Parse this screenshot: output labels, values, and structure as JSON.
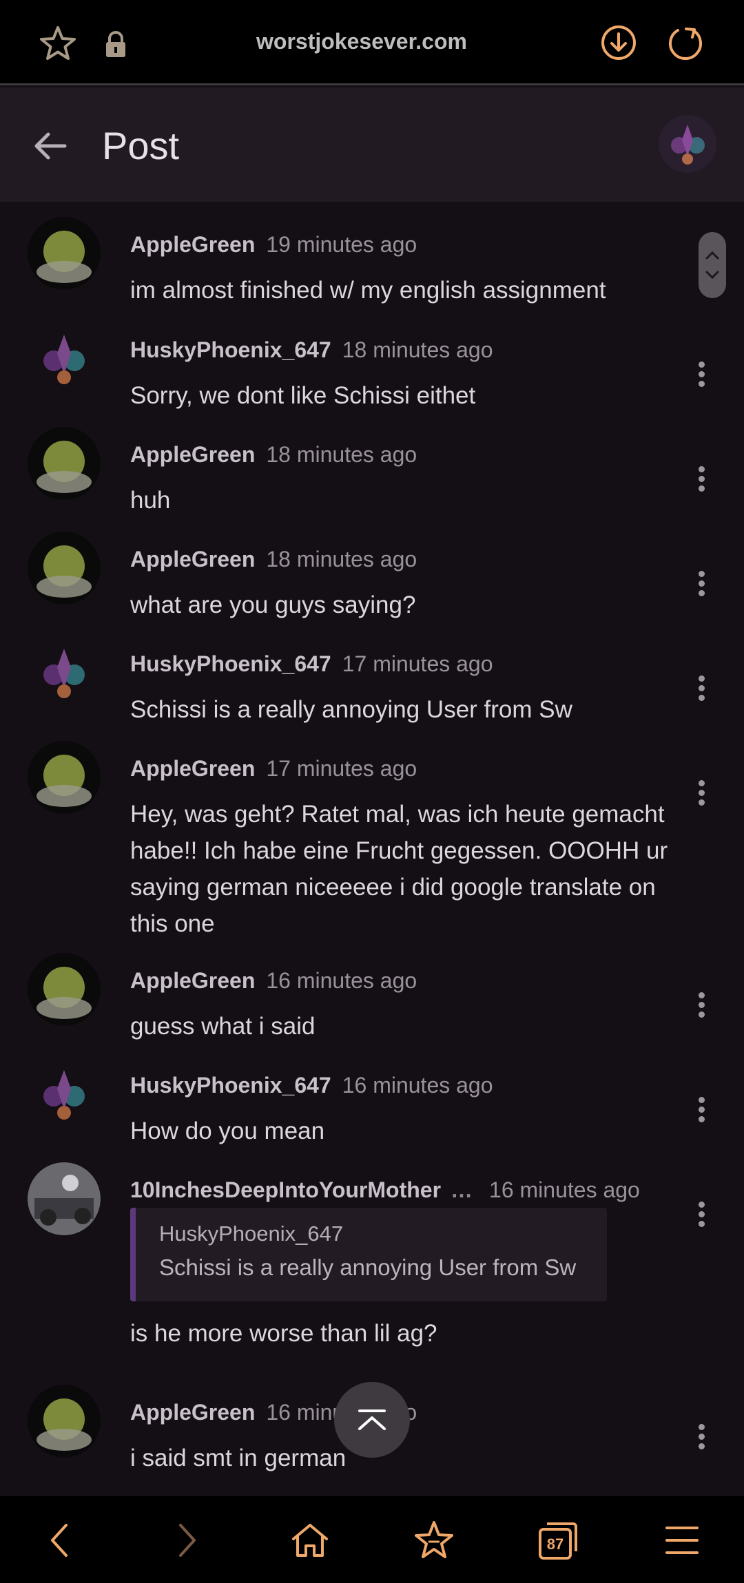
{
  "browser": {
    "url": "worstjokesever.com",
    "tab_count": "87",
    "accent_color": "#f0a86a"
  },
  "header": {
    "title": "Post"
  },
  "comments": [
    {
      "author": "AppleGreen",
      "time": "19 minutes ago",
      "text": "im almost finished w/ my english assignment",
      "avatar": "apple-avatar"
    },
    {
      "author": "HuskyPhoenix_647",
      "time": "18 minutes ago",
      "text": "Sorry, we dont like Schissi eithet",
      "avatar": "phoenix-avatar"
    },
    {
      "author": "AppleGreen",
      "time": "18 minutes ago",
      "text": "huh",
      "avatar": "apple-avatar"
    },
    {
      "author": "AppleGreen",
      "time": "18 minutes ago",
      "text": "what are you guys saying?",
      "avatar": "apple-avatar"
    },
    {
      "author": "HuskyPhoenix_647",
      "time": "17 minutes ago",
      "text": "Schissi is a really annoying User from Sw",
      "avatar": "phoenix-avatar"
    },
    {
      "author": "AppleGreen",
      "time": "17 minutes ago",
      "text": "Hey, was geht? Ratet mal, was ich heute gemacht habe!! Ich habe eine Frucht gegessen. OOOHH ur saying german niceeeee i did google translate on this one",
      "avatar": "apple-avatar"
    },
    {
      "author": "AppleGreen",
      "time": "16 minutes ago",
      "text": "guess what i said",
      "avatar": "apple-avatar"
    },
    {
      "author": "HuskyPhoenix_647",
      "time": "16 minutes ago",
      "text": "How do you mean",
      "avatar": "phoenix-avatar"
    },
    {
      "author": "10InchesDeepIntoYourMother",
      "author_badge": "…",
      "time": "16 minutes ago",
      "quote_author": "HuskyPhoenix_647",
      "quote_text": "Schissi is a really annoying User from Sw",
      "text": "is he more worse than lil ag?",
      "avatar": "photo-avatar"
    },
    {
      "author": "AppleGreen",
      "time": "16 minutes ago",
      "text": "i said smt in german",
      "avatar": "apple-avatar"
    }
  ]
}
